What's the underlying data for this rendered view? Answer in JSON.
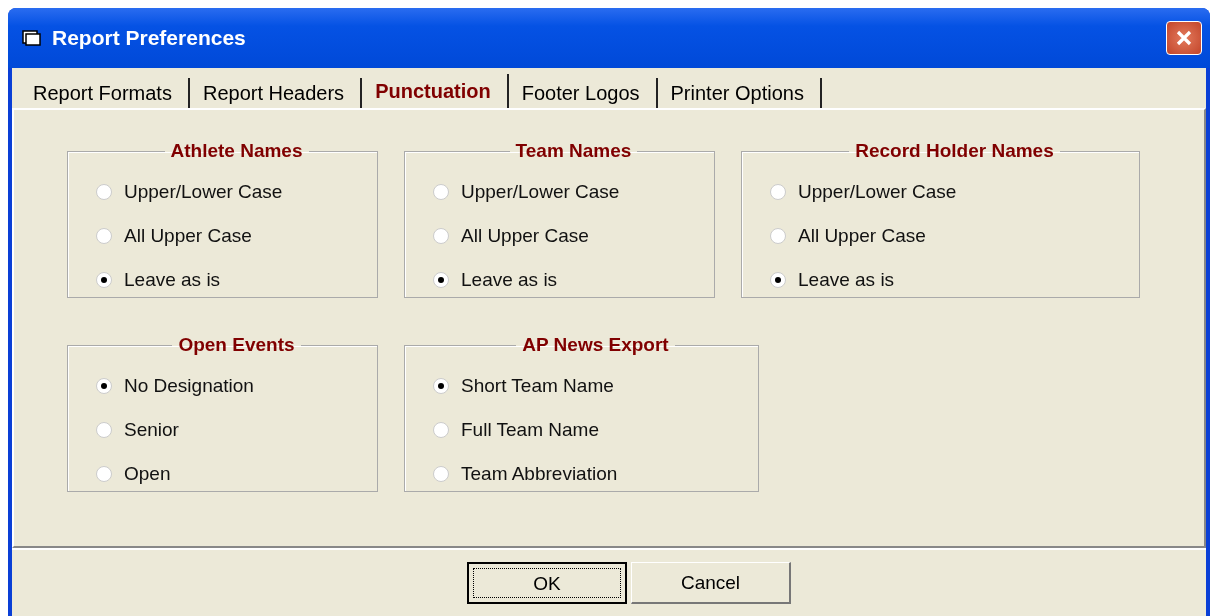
{
  "window": {
    "title": "Report Preferences"
  },
  "tabs": [
    {
      "label": "Report Formats",
      "selected": false
    },
    {
      "label": "Report Headers",
      "selected": false
    },
    {
      "label": "Punctuation",
      "selected": true
    },
    {
      "label": "Footer Logos",
      "selected": false
    },
    {
      "label": "Printer Options",
      "selected": false
    }
  ],
  "group_rows": [
    {
      "groups": [
        {
          "title": "Athlete Names",
          "options": [
            {
              "label": "Upper/Lower Case",
              "selected": false
            },
            {
              "label": "All Upper Case",
              "selected": false
            },
            {
              "label": "Leave as is",
              "selected": true
            }
          ]
        },
        {
          "title": "Team Names",
          "options": [
            {
              "label": "Upper/Lower Case",
              "selected": false
            },
            {
              "label": "All Upper Case",
              "selected": false
            },
            {
              "label": "Leave as is",
              "selected": true
            }
          ]
        },
        {
          "title": "Record Holder Names",
          "options": [
            {
              "label": "Upper/Lower Case",
              "selected": false
            },
            {
              "label": "All Upper Case",
              "selected": false
            },
            {
              "label": "Leave as is",
              "selected": true
            }
          ]
        }
      ]
    },
    {
      "groups": [
        {
          "title": "Open Events",
          "options": [
            {
              "label": "No Designation",
              "selected": true
            },
            {
              "label": "Senior",
              "selected": false
            },
            {
              "label": "Open",
              "selected": false
            }
          ]
        },
        {
          "title": "AP News Export",
          "options": [
            {
              "label": "Short Team Name",
              "selected": true
            },
            {
              "label": "Full Team Name",
              "selected": false
            },
            {
              "label": "Team Abbreviation",
              "selected": false
            }
          ]
        }
      ]
    }
  ],
  "buttons": [
    {
      "label": "OK",
      "default": true
    },
    {
      "label": "Cancel",
      "default": false
    }
  ]
}
